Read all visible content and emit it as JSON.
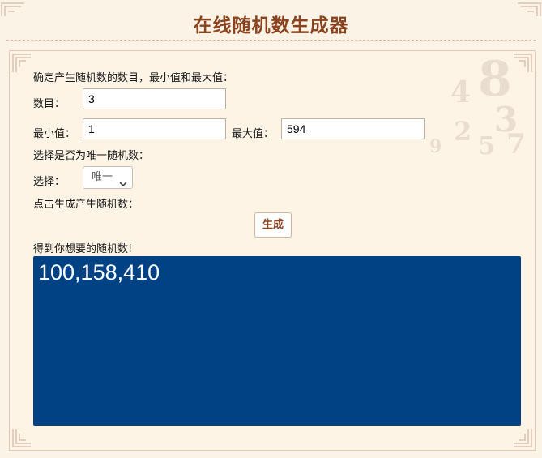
{
  "header": {
    "title": "在线随机数生成器"
  },
  "form": {
    "instruction": "确定产生随机数的数目，最小值和最大值：",
    "count_label": "数目：",
    "count_value": "3",
    "min_label": "最小值：",
    "min_value": "1",
    "max_label": "最大值：",
    "max_value": "594",
    "unique_prompt": "选择是否为唯一随机数：",
    "choice_label": "选择：",
    "choice_selected": "唯一",
    "generate_prompt": "点击生成产生随机数：",
    "generate_button": "生成",
    "result_prompt": "得到你想要的随机数!"
  },
  "result": {
    "value": "100,158,410",
    "background_color": "#004283"
  },
  "colors": {
    "title": "#8a4420",
    "page_background": "#fbf3e6"
  },
  "icons": {
    "select_arrow": "chevron-down-icon"
  }
}
